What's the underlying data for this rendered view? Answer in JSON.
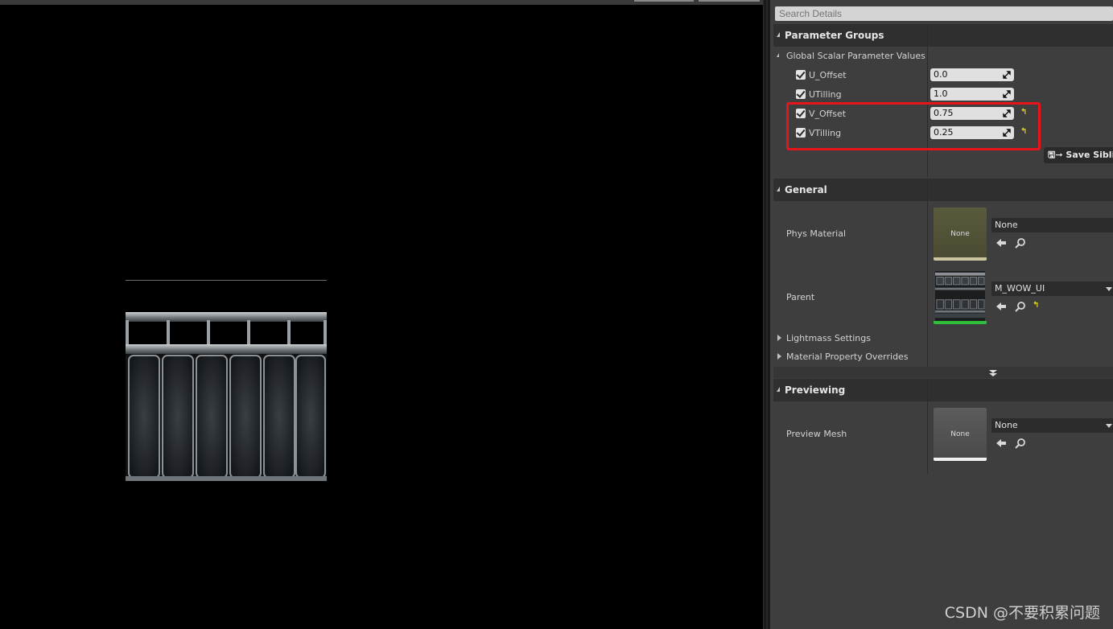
{
  "details": {
    "search_placeholder": "Search Details",
    "parameter_groups": {
      "header": "Parameter Groups",
      "subgroup": "Global Scalar Parameter Values",
      "params": [
        {
          "name": "U_Offset",
          "value": "0.0"
        },
        {
          "name": "UTilling",
          "value": "1.0"
        },
        {
          "name": "V_Offset",
          "value": "0.75"
        },
        {
          "name": "VTilling",
          "value": "0.25"
        }
      ],
      "save_button": "Save Sibli"
    },
    "general": {
      "header": "General",
      "phys_material_label": "Phys Material",
      "phys_material_thumb": "None",
      "phys_material_value": "None",
      "parent_label": "Parent",
      "parent_value": "M_WOW_UI",
      "lightmass": "Lightmass Settings",
      "overrides": "Material Property Overrides"
    },
    "previewing": {
      "header": "Previewing",
      "preview_mesh_label": "Preview Mesh",
      "preview_mesh_thumb": "None",
      "preview_mesh_value": "None"
    }
  },
  "watermark": "CSDN @不要积累问题",
  "colors": {
    "highlight": "#e8141c",
    "reset_arrow": "#e6d51e",
    "panel_bg": "#3e3e3e",
    "header_bg": "#2f2f2f"
  }
}
